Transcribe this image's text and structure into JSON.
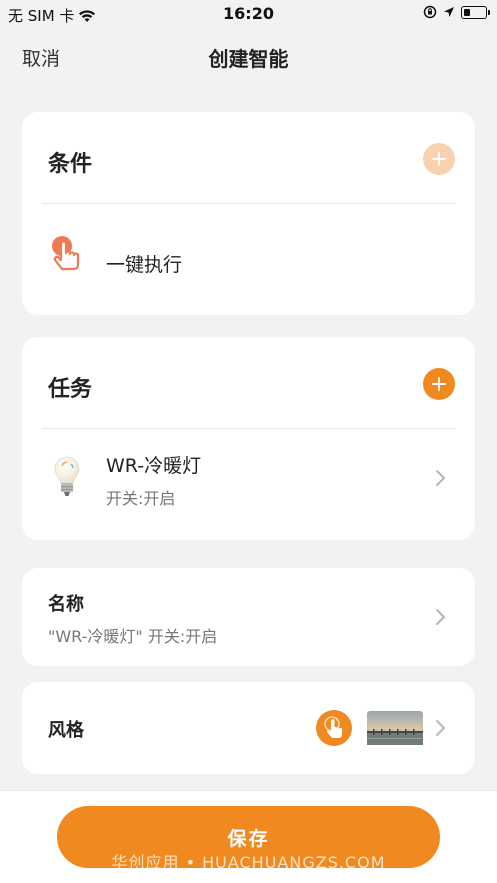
{
  "status_bar": {
    "carrier": "无 SIM 卡",
    "time": "16:20"
  },
  "nav": {
    "cancel": "取消",
    "title": "创建智能"
  },
  "conditions": {
    "header": "条件",
    "items": [
      {
        "label": "一键执行",
        "icon": "tap-hand-icon"
      }
    ]
  },
  "tasks": {
    "header": "任务",
    "items": [
      {
        "title": "WR-冷暖灯",
        "subtitle": "开关:开启",
        "icon": "light-bulb-icon"
      }
    ]
  },
  "name": {
    "label": "名称",
    "value": "\"WR-冷暖灯\" 开关:开启"
  },
  "style": {
    "label": "风格"
  },
  "save": {
    "label": "保存",
    "watermark": "华创应用 • HUACHUANGZS.COM"
  },
  "colors": {
    "accent": "#f0891f",
    "accent_light": "#f8d2ae",
    "background": "#f2f2f2"
  }
}
